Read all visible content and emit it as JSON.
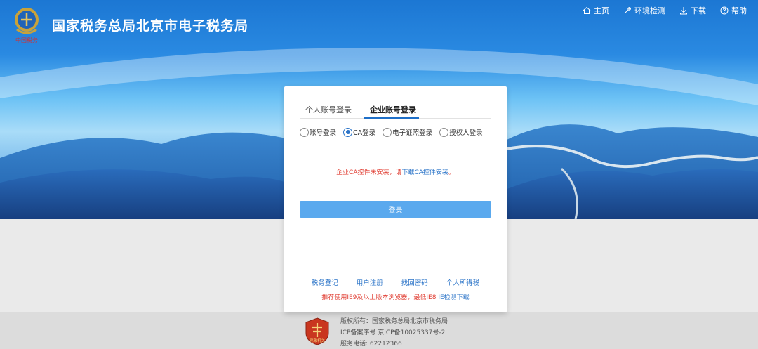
{
  "header": {
    "title": "国家税务总局北京市电子税务局",
    "logo_caption": "中国税务",
    "nav": [
      {
        "icon": "home-icon",
        "label": "主页"
      },
      {
        "icon": "tools-icon",
        "label": "环境检测"
      },
      {
        "icon": "download-icon",
        "label": "下载"
      },
      {
        "icon": "help-icon",
        "label": "帮助"
      }
    ]
  },
  "login": {
    "tabs": [
      "个人账号登录",
      "企业账号登录"
    ],
    "active_tab": 1,
    "radios": [
      {
        "label": "账号登录",
        "checked": false
      },
      {
        "label": "CA登录",
        "checked": true
      },
      {
        "label": "电子证照登录",
        "checked": false
      },
      {
        "label": "授权人登录",
        "checked": false
      }
    ],
    "warning_prefix": "企业CA控件未安装，请",
    "warning_link": "下载CA控件安装",
    "warning_suffix": "。",
    "button_label": "登录",
    "links": [
      "税务登记",
      "用户注册",
      "找回密码",
      "个人所得税"
    ],
    "browser_note": "推荐使用IE9及以上版本浏览器，最低IE8",
    "browser_link": "IE检测下载"
  },
  "footer": {
    "badge_label": "党政机关",
    "lines": [
      "版权所有：国家税务总局北京市税务局",
      "ICP备案序号 京ICP备10025337号-2",
      "服务电话: 62212366"
    ]
  },
  "colors": {
    "primary": "#2b74c8",
    "button": "#5aa9ee",
    "warning": "#e03c31",
    "banner": "#2b8fe6"
  }
}
